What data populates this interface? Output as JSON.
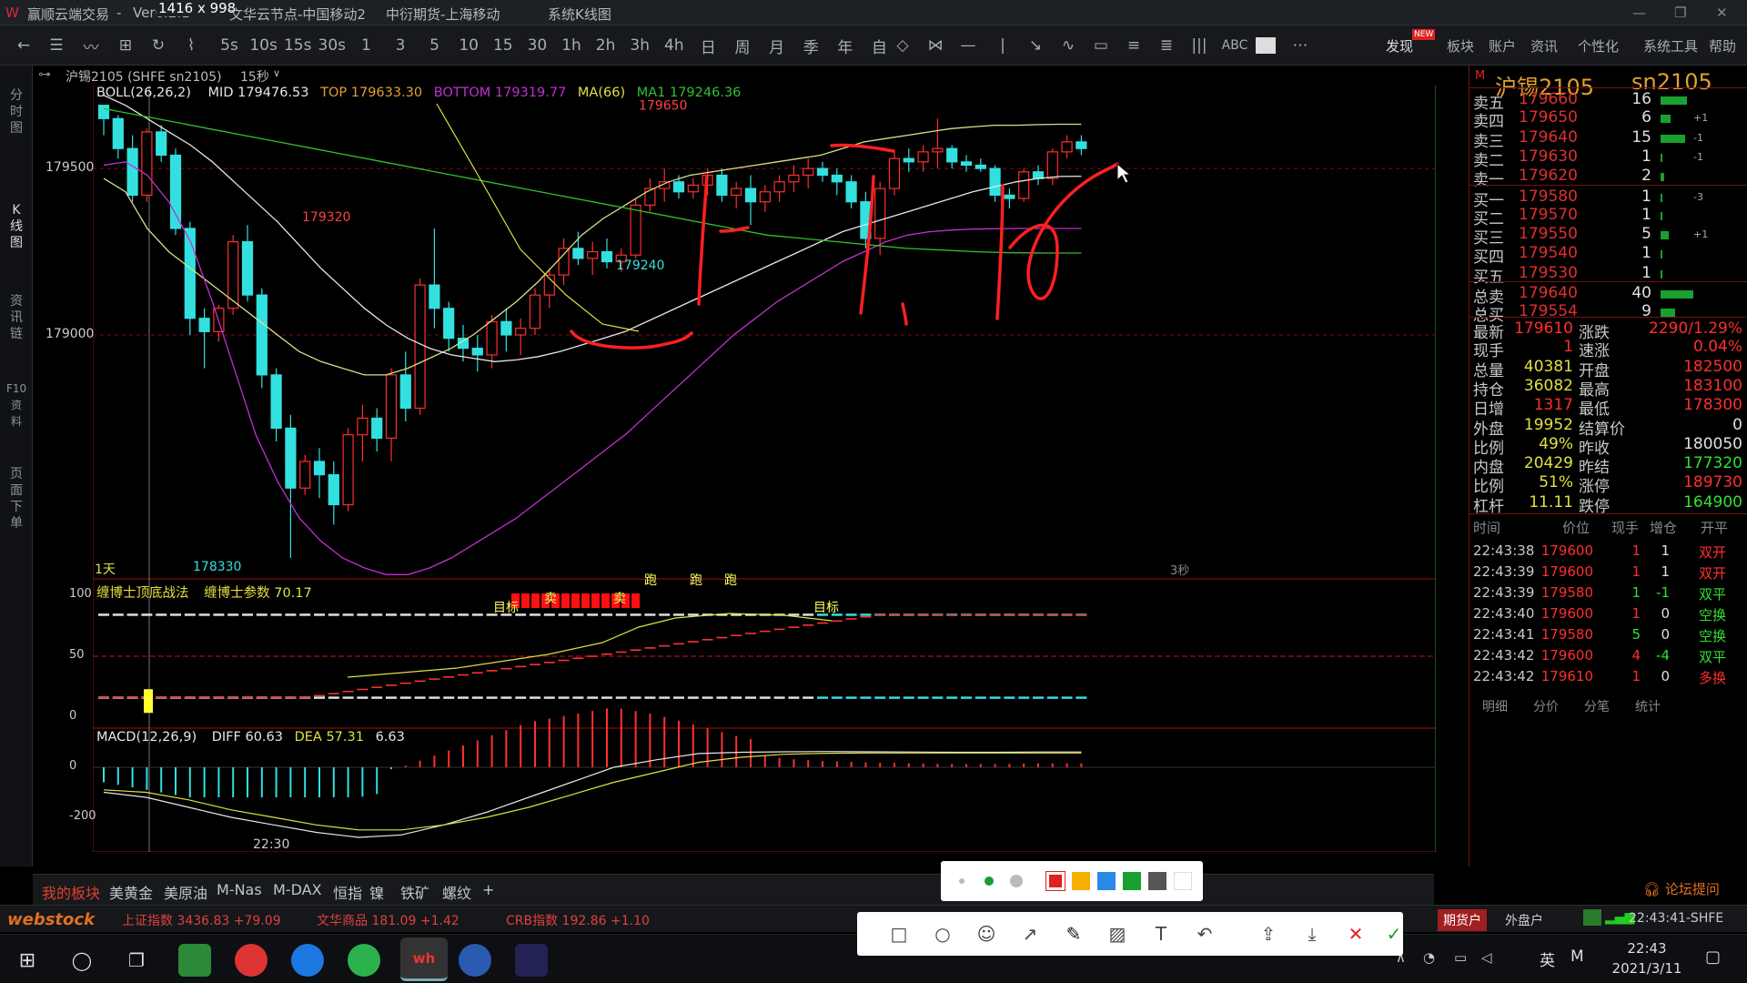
{
  "titlebar": {
    "app_name": "赢顺云端交易",
    "version": "Ver6.2.1",
    "node": "文华云节点-中国移动2",
    "futures": "中衍期货-上海移动",
    "view": "系统K线图",
    "overlay_size": "1416 x 998"
  },
  "toolbar": {
    "periods": [
      "5s",
      "10s",
      "15s",
      "30s",
      "1",
      "3",
      "5",
      "10",
      "15",
      "30",
      "1h",
      "2h",
      "3h",
      "4h",
      "日",
      "周",
      "月",
      "季",
      "年",
      "自"
    ],
    "abc_label": "ABC",
    "discover_label": "发现",
    "new_badge": "NEW",
    "right_menu": [
      "板块",
      "账户",
      "资讯",
      "个性化",
      "系统工具",
      "帮助"
    ]
  },
  "sidebar": [
    "分时图",
    "K线图",
    "资讯链",
    "F10资料",
    "页面下单"
  ],
  "instrument_bar": {
    "label": "沪锡2105 (SHFE sn2105)",
    "period": "15秒"
  },
  "main_indicator": {
    "boll": "BOLL(26,26,2)",
    "mid": "MID 179476.53",
    "top": "TOP 179633.30",
    "bottom": "BOTTOM 179319.77",
    "ma66": "MA(66)",
    "ma1": "MA1 179246.36",
    "y_ticks": [
      "179500",
      "179000"
    ],
    "annotations": [
      "179650",
      "179320",
      "179240",
      "178330"
    ],
    "period_tag": "1天",
    "scale_tag": "3秒"
  },
  "sub1": {
    "title": "缠博士顶底战法",
    "param": "缠博士参数 70.17",
    "y_ticks": [
      "100",
      "50",
      "0"
    ],
    "signals": [
      "目标",
      "卖",
      "卖",
      "跑",
      "跑",
      "跑",
      "目标"
    ]
  },
  "sub2": {
    "title": "MACD(12,26,9)",
    "diff": "DIFF 60.63",
    "dea": "DEA 57.31",
    "macd": "6.63",
    "y_ticks": [
      "0",
      "-200"
    ],
    "time_label": "22:30"
  },
  "chart_data": {
    "type": "candlestick",
    "title": "沪锡2105 sn2105 15秒",
    "ylim": [
      178300,
      179700
    ],
    "candles": [
      [
        179690,
        179690,
        179600,
        179650
      ],
      [
        179650,
        179660,
        179530,
        179560
      ],
      [
        179560,
        179600,
        179400,
        179420
      ],
      [
        179420,
        179620,
        179400,
        179610
      ],
      [
        179610,
        179630,
        179520,
        179540
      ],
      [
        179540,
        179560,
        179300,
        179320
      ],
      [
        179320,
        179340,
        179000,
        179050
      ],
      [
        179050,
        179080,
        178900,
        179010
      ],
      [
        179010,
        179090,
        178980,
        179080
      ],
      [
        179080,
        179300,
        179060,
        179280
      ],
      [
        179280,
        179330,
        179100,
        179120
      ],
      [
        179120,
        179140,
        178840,
        178880
      ],
      [
        178880,
        178900,
        178680,
        178720
      ],
      [
        178720,
        178760,
        178330,
        178540
      ],
      [
        178540,
        178640,
        178520,
        178620
      ],
      [
        178620,
        178660,
        178510,
        178580
      ],
      [
        178580,
        178620,
        178430,
        178490
      ],
      [
        178490,
        178720,
        178470,
        178700
      ],
      [
        178700,
        178790,
        178620,
        178750
      ],
      [
        178750,
        178780,
        178650,
        178690
      ],
      [
        178690,
        178900,
        178620,
        178880
      ],
      [
        178880,
        178950,
        178740,
        178780
      ],
      [
        178780,
        179170,
        178760,
        179150
      ],
      [
        179150,
        179320,
        179020,
        179080
      ],
      [
        179080,
        179100,
        178950,
        178990
      ],
      [
        178990,
        179030,
        178920,
        178960
      ],
      [
        178960,
        179000,
        178890,
        178940
      ],
      [
        178940,
        179060,
        178900,
        179040
      ],
      [
        179040,
        179080,
        178950,
        179000
      ],
      [
        179000,
        179050,
        178940,
        179020
      ],
      [
        179020,
        179140,
        179000,
        179120
      ],
      [
        179120,
        179200,
        179080,
        179180
      ],
      [
        179180,
        179290,
        179150,
        179260
      ],
      [
        179260,
        179310,
        179210,
        179230
      ],
      [
        179230,
        179280,
        179180,
        179250
      ],
      [
        179250,
        179290,
        179200,
        179220
      ],
      [
        179220,
        179260,
        179190,
        179240
      ],
      [
        179240,
        179410,
        179230,
        179390
      ],
      [
        179390,
        179470,
        179370,
        179440
      ],
      [
        179440,
        179500,
        179400,
        179460
      ],
      [
        179460,
        179480,
        179410,
        179430
      ],
      [
        179430,
        179470,
        179410,
        179450
      ],
      [
        179450,
        179500,
        179420,
        179480
      ],
      [
        179480,
        179500,
        179400,
        179420
      ],
      [
        179420,
        179460,
        179380,
        179440
      ],
      [
        179440,
        179480,
        179330,
        179400
      ],
      [
        179400,
        179450,
        179370,
        179430
      ],
      [
        179430,
        179480,
        179400,
        179460
      ],
      [
        179460,
        179510,
        179430,
        179480
      ],
      [
        179480,
        179530,
        179440,
        179500
      ],
      [
        179500,
        179520,
        179460,
        179480
      ],
      [
        179480,
        179500,
        179420,
        179460
      ],
      [
        179460,
        179480,
        179380,
        179400
      ],
      [
        179400,
        179430,
        179260,
        179290
      ],
      [
        179290,
        179460,
        179240,
        179440
      ],
      [
        179440,
        179550,
        179420,
        179530
      ],
      [
        179530,
        179560,
        179490,
        179520
      ],
      [
        179520,
        179570,
        179490,
        179550
      ],
      [
        179550,
        179650,
        179500,
        179560
      ],
      [
        179560,
        179570,
        179500,
        179520
      ],
      [
        179520,
        179540,
        179490,
        179510
      ],
      [
        179510,
        179530,
        179490,
        179500
      ],
      [
        179500,
        179510,
        179400,
        179420
      ],
      [
        179420,
        179440,
        179380,
        179410
      ],
      [
        179410,
        179500,
        179400,
        179490
      ],
      [
        179490,
        179510,
        179450,
        179470
      ],
      [
        179470,
        179560,
        179450,
        179550
      ],
      [
        179550,
        179600,
        179530,
        179580
      ],
      [
        179580,
        179600,
        179540,
        179560
      ]
    ],
    "boll_upper": [
      179470,
      179430,
      179320,
      179250,
      179200,
      179150,
      179100,
      179050,
      179000,
      178950,
      178920,
      178900,
      178880,
      178880,
      178900,
      178930,
      178960,
      179000,
      179050,
      179100,
      179160,
      179230,
      179300,
      179350,
      179390,
      179430,
      179460,
      179480,
      179490,
      179500,
      179510,
      179520,
      179530,
      179540,
      179560,
      179580,
      179590,
      179600,
      179610,
      179620,
      179625,
      179630,
      179630,
      179632,
      179633,
      179633
    ],
    "boll_mid": [
      179720,
      179690,
      179650,
      179610,
      179570,
      179520,
      179460,
      179400,
      179340,
      179270,
      179200,
      179140,
      179080,
      179030,
      178990,
      178960,
      178940,
      178930,
      178920,
      178925,
      178935,
      178950,
      178970,
      178990,
      179010,
      179040,
      179070,
      179100,
      179130,
      179160,
      179190,
      179220,
      179250,
      179280,
      179310,
      179330,
      179350,
      179370,
      179390,
      179410,
      179430,
      179445,
      179460,
      179470,
      179476,
      179477
    ],
    "boll_lower": [
      179510,
      179520,
      179480,
      179400,
      179280,
      179100,
      178900,
      178700,
      178560,
      178450,
      178380,
      178330,
      178300,
      178280,
      178280,
      178300,
      178330,
      178370,
      178410,
      178450,
      178500,
      178550,
      178600,
      178650,
      178700,
      178760,
      178820,
      178880,
      178940,
      179000,
      179050,
      179100,
      179140,
      179180,
      179220,
      179250,
      179280,
      179300,
      179310,
      179315,
      179318,
      179319,
      179320,
      179320,
      179320,
      179320
    ],
    "ma66": [
      179680,
      179660,
      179640,
      179620,
      179600,
      179580,
      179560,
      179540,
      179520,
      179500,
      179480,
      179460,
      179440,
      179420,
      179400,
      179380,
      179360,
      179340,
      179320,
      179300,
      179290,
      179280,
      179270,
      179260,
      179255,
      179250,
      179247,
      179246,
      179246
    ],
    "macd_diff": [
      -100,
      -120,
      -160,
      -200,
      -230,
      -260,
      -280,
      -270,
      -230,
      -180,
      -120,
      -60,
      0,
      30,
      55,
      60,
      62,
      63,
      62,
      61,
      60,
      60,
      61,
      61
    ],
    "macd_dea": [
      -90,
      -100,
      -130,
      -170,
      -200,
      -230,
      -250,
      -250,
      -230,
      -200,
      -160,
      -110,
      -60,
      -20,
      20,
      40,
      52,
      56,
      57,
      57,
      57,
      57,
      57,
      57
    ]
  },
  "right_panel": {
    "title": "沪锡2105",
    "code": "sn2105",
    "asks": [
      {
        "label": "卖五",
        "price": "179660",
        "vol": "16",
        "chg": ""
      },
      {
        "label": "卖四",
        "price": "179650",
        "vol": "6",
        "chg": "+1"
      },
      {
        "label": "卖三",
        "price": "179640",
        "vol": "15",
        "chg": "-1"
      },
      {
        "label": "卖二",
        "price": "179630",
        "vol": "1",
        "chg": "-1"
      },
      {
        "label": "卖一",
        "price": "179620",
        "vol": "2",
        "chg": ""
      }
    ],
    "bids": [
      {
        "label": "买一",
        "price": "179580",
        "vol": "1",
        "chg": "-3"
      },
      {
        "label": "买二",
        "price": "179570",
        "vol": "1",
        "chg": ""
      },
      {
        "label": "买三",
        "price": "179550",
        "vol": "5",
        "chg": "+1"
      },
      {
        "label": "买四",
        "price": "179540",
        "vol": "1",
        "chg": ""
      },
      {
        "label": "买五",
        "price": "179530",
        "vol": "1",
        "chg": ""
      }
    ],
    "totals": [
      {
        "label": "总卖",
        "price": "179640",
        "vol": "40"
      },
      {
        "label": "总买",
        "price": "179554",
        "vol": "9"
      }
    ],
    "stats": [
      {
        "l1": "最新",
        "v1": "179610",
        "l2": "涨跌",
        "v2": "2290/1.29%"
      },
      {
        "l1": "现手",
        "v1": "1",
        "l2": "速涨",
        "v2": "0.04%"
      },
      {
        "l1": "总量",
        "v1": "40381",
        "l2": "开盘",
        "v2": "182500"
      },
      {
        "l1": "持仓",
        "v1": "36082",
        "l2": "最高",
        "v2": "183100"
      },
      {
        "l1": "日增",
        "v1": "1317",
        "l2": "最低",
        "v2": "178300"
      },
      {
        "l1": "外盘",
        "v1": "19952",
        "l2": "结算价",
        "v2": "0"
      },
      {
        "l1": "比例",
        "v1": "49%",
        "l2": "昨收",
        "v2": "180050"
      },
      {
        "l1": "内盘",
        "v1": "20429",
        "l2": "昨结",
        "v2": "177320"
      },
      {
        "l1": "比例",
        "v1": "51%",
        "l2": "涨停",
        "v2": "189730"
      },
      {
        "l1": "杠杆",
        "v1": "11.11",
        "l2": "跌停",
        "v2": "164900"
      }
    ],
    "trade_headers": [
      "时间",
      "价位",
      "现手",
      "增仓",
      "开平"
    ],
    "trades": [
      [
        "22:43:38",
        "179600",
        "1",
        "1",
        "双开"
      ],
      [
        "22:43:39",
        "179600",
        "1",
        "1",
        "双开"
      ],
      [
        "22:43:39",
        "179580",
        "1",
        "-1",
        "双平"
      ],
      [
        "22:43:40",
        "179600",
        "1",
        "0",
        "空换"
      ],
      [
        "22:43:41",
        "179580",
        "5",
        "0",
        "空换"
      ],
      [
        "22:43:42",
        "179600",
        "4",
        "-4",
        "双平"
      ],
      [
        "22:43:42",
        "179610",
        "1",
        "0",
        "多换"
      ]
    ],
    "bottom_tabs": [
      "明细",
      "分价",
      "分笔",
      "统计"
    ]
  },
  "tabs": [
    "我的板块",
    "美黄金",
    "美原油",
    "M-Nas",
    "M-DAX",
    "恒指",
    "镍",
    "铁矿",
    "螺纹",
    "+"
  ],
  "statusbar": {
    "logo": "webstock",
    "index1": "上证指数 3436.83 +79.09",
    "index2": "文华商品 181.09 +1.42",
    "index3": "CRB指数 192.86 +1.10",
    "forum": "论坛提问",
    "acct1": "期货户",
    "acct2": "外盘户",
    "clock": "22:43:41-SHFE"
  },
  "taskbar": {
    "time": "22:43",
    "date": "2021/3/11",
    "ime": "英"
  },
  "colors": {
    "up": "#ff2e2e",
    "down": "#33e0e0",
    "mid": "#e6e6e6",
    "top": "#d8e08a",
    "bottom": "#c030d0",
    "ma66": "#30c030",
    "accent": "#e0a030"
  }
}
